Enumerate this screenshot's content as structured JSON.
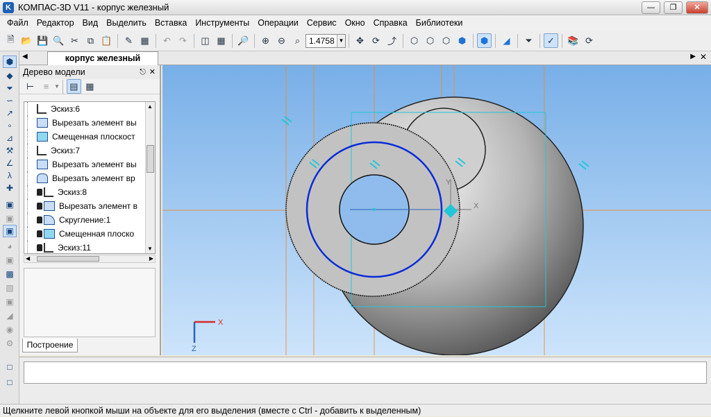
{
  "window": {
    "title": "КОМПАС-3D V11 - корпус железный"
  },
  "menu": [
    "Файл",
    "Редактор",
    "Вид",
    "Выделить",
    "Вставка",
    "Инструменты",
    "Операции",
    "Сервис",
    "Окно",
    "Справка",
    "Библиотеки"
  ],
  "toolbar": {
    "zoom_value": "1.4758",
    "icons": [
      "new-file-icon",
      "open-file-icon",
      "save-icon",
      "preview-icon",
      "cut-icon",
      "copy-icon",
      "paste-icon",
      "properties-icon",
      "manager-icon",
      "undo-icon",
      "redo-icon",
      "variables-icon",
      "grid-icon",
      "zoom-window-icon",
      "zoom-in-icon",
      "zoom-out-icon",
      "zoom-scale-icon",
      "pan-icon",
      "rotate-icon",
      "orientation-icon",
      "wireframe-icon",
      "hidden-lines-icon",
      "hidden-gray-icon",
      "halftone-icon",
      "halftone-edges-icon",
      "perspective-icon",
      "filter-icon",
      "select-icon",
      "library-icon",
      "refresh-icon"
    ]
  },
  "document": {
    "tab_label": "корпус железный"
  },
  "tree": {
    "title": "Дерево модели",
    "build_tab": "Построение",
    "items": [
      {
        "label": "Эскиз:6",
        "icon": "sketch-icon",
        "locked": false
      },
      {
        "label": "Вырезать элемент вы",
        "icon": "cut-extrude-icon",
        "locked": false
      },
      {
        "label": "Смещенная плоскост",
        "icon": "offset-plane-icon",
        "locked": false
      },
      {
        "label": "Эскиз:7",
        "icon": "sketch-icon",
        "locked": false
      },
      {
        "label": "Вырезать элемент вы",
        "icon": "cut-extrude-icon",
        "locked": false
      },
      {
        "label": "Вырезать элемент вр",
        "icon": "cut-revolve-icon",
        "locked": false
      },
      {
        "label": "Эскиз:8",
        "icon": "sketch-icon",
        "locked": true
      },
      {
        "label": "Вырезать элемент в",
        "icon": "cut-extrude-icon",
        "locked": true
      },
      {
        "label": "Скругление:1",
        "icon": "fillet-icon",
        "locked": true
      },
      {
        "label": "Смещенная плоско",
        "icon": "offset-plane-icon",
        "locked": true
      },
      {
        "label": "Эскиз:11",
        "icon": "sketch-icon",
        "locked": true
      }
    ]
  },
  "viewport": {
    "axis_x": "X",
    "axis_z": "Z",
    "local_x": "X",
    "local_y": "Y",
    "colors": {
      "background_top": "#78afe8",
      "background_bottom": "#cde4fb",
      "sketch": "#0a2bd6",
      "construction": "#f08a24",
      "highlight": "#21c6d8"
    }
  },
  "status": {
    "hint": "Щелкните левой кнопкой мыши на объекте для его выделения (вместе с Ctrl - добавить к выделенным)"
  }
}
